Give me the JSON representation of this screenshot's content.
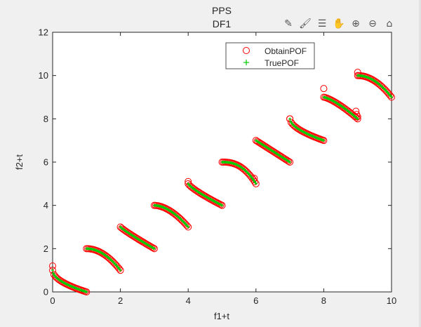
{
  "toolbar": {
    "items": [
      {
        "name": "edit-plot-icon",
        "glyph": "✎"
      },
      {
        "name": "brush-icon",
        "glyph": "🖌"
      },
      {
        "name": "legend-icon",
        "glyph": "☰"
      },
      {
        "name": "pan-icon",
        "glyph": "✋"
      },
      {
        "name": "zoom-in-icon",
        "glyph": "⊕"
      },
      {
        "name": "zoom-out-icon",
        "glyph": "⊖"
      },
      {
        "name": "home-icon",
        "glyph": "⌂"
      }
    ]
  },
  "chart_data": {
    "type": "scatter",
    "title": [
      "PPS",
      "DF1"
    ],
    "xlabel": "f1+t",
    "ylabel": "f2+t",
    "xlim": [
      0,
      10
    ],
    "ylim": [
      0,
      12
    ],
    "xticks": [
      0,
      2,
      4,
      6,
      8,
      10
    ],
    "yticks": [
      0,
      2,
      4,
      6,
      8,
      10,
      12
    ],
    "legend": {
      "location": "top-right",
      "entries": [
        "ObtainPOF",
        "TruePOF"
      ]
    },
    "colors": {
      "obtain": "#ff0000",
      "true": "#00cc00"
    },
    "fronts": [
      {
        "t": 0,
        "exponent": 0.5
      },
      {
        "t": 1,
        "exponent": 2.0
      },
      {
        "t": 2,
        "exponent": 0.9
      },
      {
        "t": 3,
        "exponent": 1.8
      },
      {
        "t": 4,
        "exponent": 0.8
      },
      {
        "t": 5,
        "exponent": 2.5
      },
      {
        "t": 6,
        "exponent": 1.0
      },
      {
        "t": 7,
        "exponent": 0.55
      },
      {
        "t": 8,
        "exponent": 1.35
      },
      {
        "t": 9,
        "exponent": 2.0
      }
    ],
    "outliers": [
      {
        "x": 0.0,
        "y": 1.2
      },
      {
        "x": 8.0,
        "y": 9.4
      },
      {
        "x": 9.0,
        "y": 10.15
      },
      {
        "x": 5.95,
        "y": 5.25
      },
      {
        "x": 8.95,
        "y": 8.35
      },
      {
        "x": 8.97,
        "y": 8.2
      },
      {
        "x": 9.0,
        "y": 8.1
      },
      {
        "x": 4.0,
        "y": 5.1
      },
      {
        "x": 7.0,
        "y": 8.0
      }
    ]
  }
}
